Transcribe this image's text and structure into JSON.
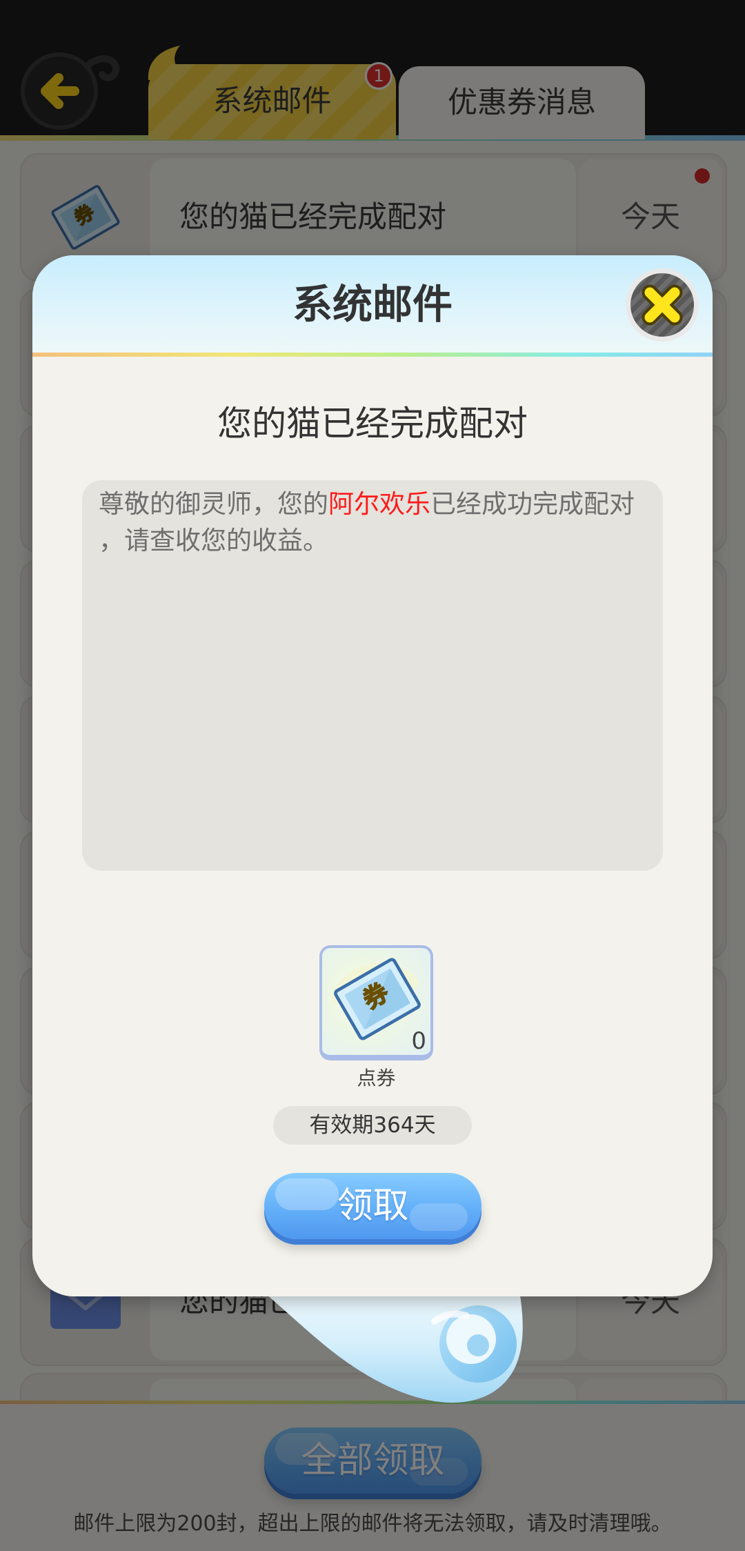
{
  "header": {
    "back_icon": "back-arrow-icon",
    "tabs": [
      {
        "label": "系统邮件",
        "state": "active",
        "badge": "1"
      },
      {
        "label": "优惠券消息",
        "state": "inactive"
      }
    ]
  },
  "icons": {
    "coupon_icon": "coupon-ticket-icon",
    "coupon_glyph": "券",
    "envelope_icon": "envelope-icon",
    "close_icon": "close-x-icon"
  },
  "mail_list": {
    "items": [
      {
        "icon": "coupon-ticket-icon",
        "title": "您的猫已经完成配对",
        "date": "今天",
        "unread": true
      },
      {
        "icon": "envelope-icon",
        "title": "您的猫已经完成配对",
        "date": "今天",
        "unread": false
      }
    ]
  },
  "bottom_bar": {
    "claim_all_label": "全部领取",
    "notice": "邮件上限为200封，超出上限的邮件将无法领取，请及时清理哦。"
  },
  "modal": {
    "title": "系统邮件",
    "subject": "您的猫已经完成配对",
    "body": {
      "before": "尊敬的御灵师，您的",
      "highlight": "阿尔欢乐",
      "after": "已经成功完成配对，请查收您的收益。"
    },
    "attachment": {
      "icon": "coupon-ticket-icon",
      "quantity": "0",
      "name": "点券"
    },
    "validity": "有效期364天",
    "claim_label": "领取"
  },
  "colors": {
    "accent_blue": "#5aa6f7",
    "tab_active_yellow": "#f5d140",
    "highlight_red": "#ff1a1a",
    "close_x_yellow": "#ffe51c",
    "unread_dot": "#d42b2b",
    "badge_red": "#e0312d"
  }
}
